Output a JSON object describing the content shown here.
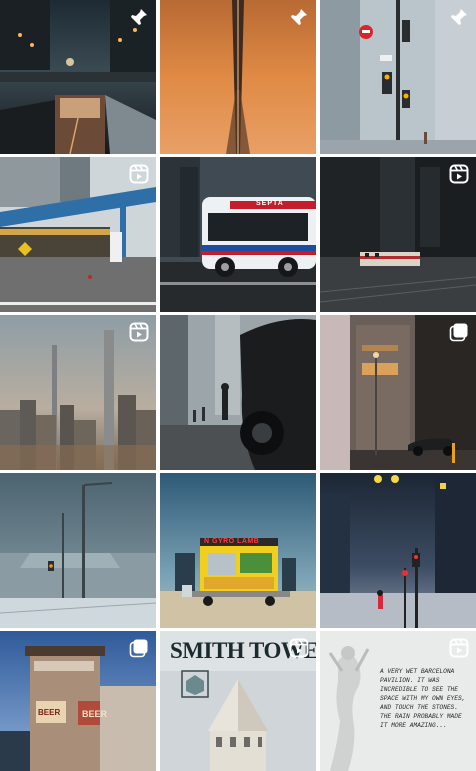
{
  "grid": {
    "tiles": [
      {
        "id": "t1",
        "badge": "pin-icon"
      },
      {
        "id": "t2",
        "badge": "pin-icon"
      },
      {
        "id": "t3",
        "badge": "pin-icon"
      },
      {
        "id": "t4",
        "badge": "reel-icon"
      },
      {
        "id": "t5",
        "badge": "none"
      },
      {
        "id": "t6",
        "badge": "reel-icon"
      },
      {
        "id": "t7",
        "badge": "reel-icon"
      },
      {
        "id": "t8",
        "badge": "none"
      },
      {
        "id": "t9",
        "badge": "carousel-icon"
      },
      {
        "id": "t10",
        "badge": "none"
      },
      {
        "id": "t11",
        "badge": "none"
      },
      {
        "id": "t12",
        "badge": "none"
      },
      {
        "id": "t13",
        "badge": "carousel-icon"
      },
      {
        "id": "t14",
        "badge": "reel-icon"
      },
      {
        "id": "t15",
        "badge": "reel-icon"
      }
    ]
  },
  "texts": {
    "bus_label": "SEPTA",
    "cart_sign": "N GYRO LAMB",
    "smith_tower": "SMITH TOWER",
    "beer_sign": "BEER",
    "store_sign": "BEER",
    "handwritten_note": "A VERY WET BARCELONA PAVILION. IT WAS INCREDIBLE TO SEE THE SPACE WITH MY OWN EYES, AND TOUCH THE STONES. THE RAIN PROBABLY MADE IT MORE AMAZING..."
  }
}
